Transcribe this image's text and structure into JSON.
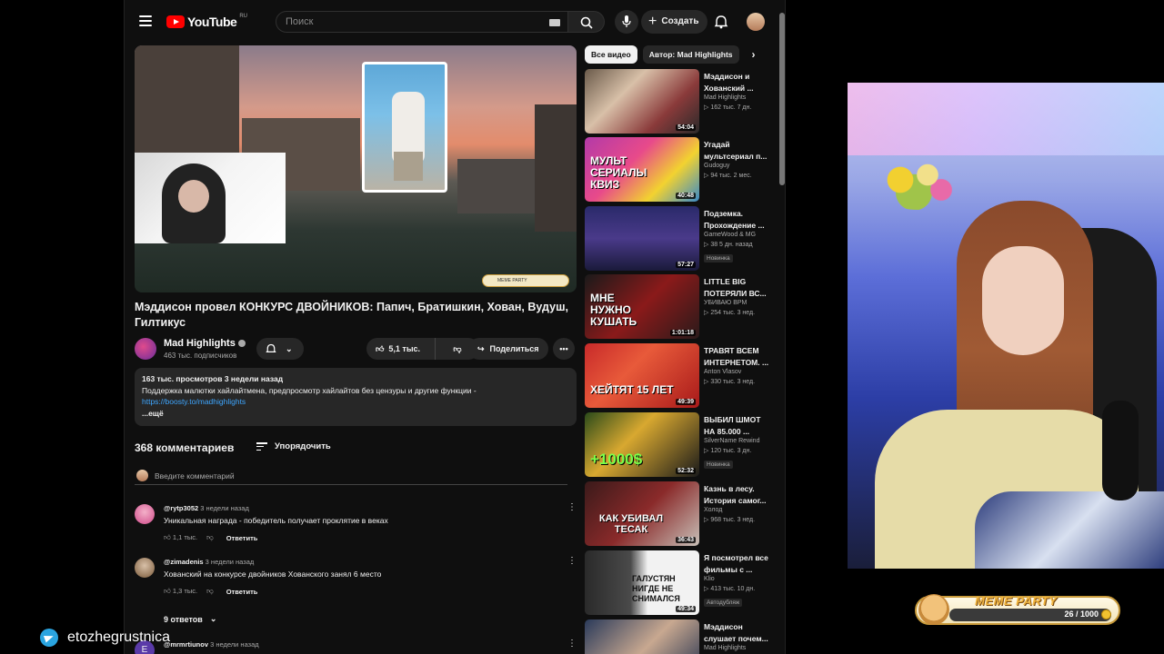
{
  "youtube": {
    "logo_text": "YouTube",
    "logo_region": "RU",
    "search_placeholder": "Поиск",
    "create_label": "Создать"
  },
  "video": {
    "title": "Мэддисон провел КОНКУРС ДВОЙНИКОВ: Папич, Братишкин, Хован, Вудуш, Гилтикус",
    "channel_name": "Mad Highlights",
    "channel_subs": "463 тыс. подписчиков",
    "likes": "5,1 тыс.",
    "share_label": "Поделиться",
    "player_overlay_label": "MEME PARTY"
  },
  "description": {
    "meta": "163 тыс. просмотров  3 недели назад",
    "text": "Поддержка малютки хайлайтмена, предпросмотр хайлайтов без цензуры и другие функции -",
    "link": "https://boosty.to/madhighlights",
    "more": "...ещё"
  },
  "comments": {
    "count_label": "368 комментариев",
    "sort_label": "Упорядочить",
    "add_placeholder": "Введите комментарий",
    "items": [
      {
        "author": "@rytp3052",
        "time": "3 недели назад",
        "text": "Уникальная награда - победитель получает проклятие в веках",
        "likes": "1,1 тыс.",
        "reply": "Ответить"
      },
      {
        "author": "@zimadenis",
        "time": "3 недели назад",
        "text": "Хованский на конкурсе двойников Хованского занял 6 место",
        "likes": "1,3 тыс.",
        "reply": "Ответить"
      },
      {
        "author": "@mrmrtiunov",
        "time": "3 недели назад",
        "initial": "E"
      }
    ],
    "replies_label": "9 ответов"
  },
  "chips": [
    "Все видео",
    "Автор: Mad Highlights"
  ],
  "recommendations": [
    {
      "title": "Мэддисон и Хованский ...",
      "channel": "Mad Highlights",
      "meta": "▷ 162 тыс.  7 дн.",
      "duration": "54:04",
      "overlay": "",
      "badge": ""
    },
    {
      "title": "Угадай мультсериал п...",
      "channel": "Gudoguy",
      "meta": "▷ 94 тыс.  2 мес.",
      "duration": "40:48",
      "overlay": "МУЛЬТ СЕРИАЛЫ КВИЗ",
      "badge": ""
    },
    {
      "title": "Подземка. Прохождение ...",
      "channel": "GameWood & MG",
      "meta": "▷ 38  5 дн. назад",
      "duration": "57:27",
      "overlay": "",
      "badge": "Новинка"
    },
    {
      "title": "LITTLE BIG ПОТЕРЯЛИ ВС...",
      "channel": "УБИВАЮ ВРМ",
      "meta": "▷ 254 тыс.  3 нед.",
      "duration": "1:01:18",
      "overlay": "МНЕ НУЖНО КУШАТЬ",
      "badge": ""
    },
    {
      "title": "ТРАВЯТ ВСЕМ ИНТЕРНЕТОМ. ...",
      "channel": "Anton Vlasov",
      "meta": "▷ 330 тыс.  3 нед.",
      "duration": "49:39",
      "overlay": "ХЕЙТЯТ 15 ЛЕТ",
      "badge": ""
    },
    {
      "title": "ВЫБИЛ ШМОТ НА 85.000 ...",
      "channel": "SilverName Rewind",
      "meta": "▷ 120 тыс.  3 дн.",
      "duration": "52:32",
      "overlay": "+1000$",
      "badge": "Новинка"
    },
    {
      "title": "Казнь в лесу. История самог...",
      "channel": "Холод",
      "meta": "▷ 968 тыс.  3 нед.",
      "duration": "36:43",
      "overlay": "КАК УБИВАЛ ТЕСАК",
      "badge": ""
    },
    {
      "title": "Я посмотрел все фильмы с ...",
      "channel": "Klio",
      "meta": "▷ 413 тыс.  10 дн.",
      "duration": "49:34",
      "overlay": "ГАЛУСТЯН НИГДЕ НЕ СНИМАЛСЯ",
      "badge": "Автодубляж"
    },
    {
      "title": "Мэддисон слушает почем...",
      "channel": "Mad Highlights",
      "meta": "",
      "duration": "",
      "overlay": "",
      "badge": ""
    }
  ],
  "meme_party": {
    "title": "MEME PARTY",
    "count": "26 / 1000",
    "progress": 0.026
  },
  "telegram": {
    "handle": "etozhegrustnica"
  },
  "colors": {
    "accent_red": "#ff0000",
    "link_blue": "#3ea6ff",
    "telegram_blue": "#2aa4e0"
  }
}
